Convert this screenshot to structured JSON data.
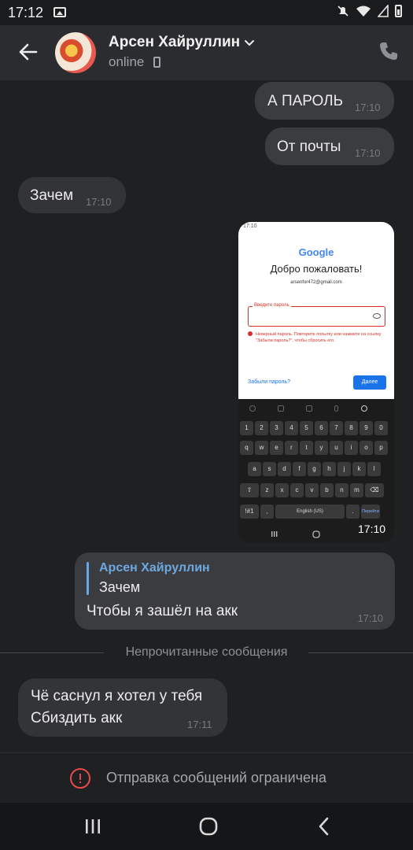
{
  "status_bar": {
    "time": "17:12"
  },
  "header": {
    "contact_name": "Арсен Хайруллин",
    "status": "online"
  },
  "messages": [
    {
      "text": "А ПАРОЛЬ",
      "time": "17:10",
      "direction": "out"
    },
    {
      "text": "От почты",
      "time": "17:10",
      "direction": "out"
    },
    {
      "text": "Зачем",
      "time": "17:10",
      "direction": "in"
    }
  ],
  "photo_message": {
    "time": "17:10",
    "screenshot": {
      "status_time": "17:10",
      "logo": "Google",
      "welcome": "Добро пожаловать!",
      "email": "arsenfor472@gmail.com",
      "field_label": "Введите пароль",
      "error": "Неверный пароль. Повторите попытку или нажмите на ссылку \"Забыли пароль?\", чтобы сбросить его.",
      "forgot_link": "Забыли пароль?",
      "next_button": "Далее",
      "keyboard": {
        "row1": [
          "1",
          "2",
          "3",
          "4",
          "5",
          "6",
          "7",
          "8",
          "9",
          "0"
        ],
        "row2": [
          "q",
          "w",
          "e",
          "r",
          "t",
          "y",
          "u",
          "i",
          "o",
          "p"
        ],
        "row3": [
          "a",
          "s",
          "d",
          "f",
          "g",
          "h",
          "j",
          "k",
          "l"
        ],
        "row4": [
          "z",
          "x",
          "c",
          "v",
          "b",
          "n",
          "m"
        ],
        "sym": "!#1",
        "comma": ",",
        "space": "English (US)",
        "period": ".",
        "action": "Перейти"
      }
    }
  },
  "reply_message": {
    "quoted_author": "Арсен Хайруллин",
    "quoted_text": "Зачем",
    "text": "Чтобы я зашёл на акк",
    "time": "17:10"
  },
  "unread_divider": "Непрочитанные сообщения",
  "incoming_last": {
    "line1": "Чё саснул я хотел у тебя",
    "line2": "Сбиздить акк",
    "time": "17:11"
  },
  "restricted_notice": "Отправка сообщений ограничена",
  "colors": {
    "background": "#1f2022",
    "header": "#2b2c2f",
    "outgoing_bubble": "#3b3c40",
    "incoming_bubble": "#333437",
    "accent_blue": "#6ea8e0",
    "warning_red": "#e84a4a"
  }
}
